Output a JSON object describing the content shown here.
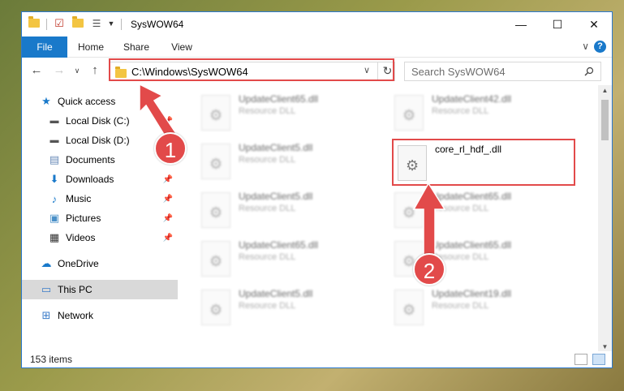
{
  "window": {
    "title": "SysWOW64",
    "minimize": "—",
    "maximize": "☐",
    "close": "✕"
  },
  "ribbon": {
    "tabs": [
      "File",
      "Home",
      "Share",
      "View"
    ],
    "expand": "∨",
    "help": "?"
  },
  "address": {
    "path": "C:\\Windows\\SysWOW64",
    "search_placeholder": "Search SysWOW64"
  },
  "nav_pane": {
    "items": [
      {
        "label": "Quick access",
        "icon": "star-icon"
      },
      {
        "label": "Local Disk (C:)",
        "icon": "drive-icon"
      },
      {
        "label": "Local Disk (D:)",
        "icon": "drive-icon"
      },
      {
        "label": "Documents",
        "icon": "documents-icon"
      },
      {
        "label": "Downloads",
        "icon": "download-icon"
      },
      {
        "label": "Music",
        "icon": "music-icon"
      },
      {
        "label": "Pictures",
        "icon": "pictures-icon"
      },
      {
        "label": "Videos",
        "icon": "videos-icon"
      },
      {
        "label": "OneDrive",
        "icon": "cloud-icon"
      },
      {
        "label": "This PC",
        "icon": "pc-icon"
      },
      {
        "label": "Network",
        "icon": "network-icon"
      }
    ]
  },
  "files": {
    "left": [
      {
        "name": "UpdateClient65.dll",
        "desc": "Resource DLL"
      },
      {
        "name": "UpdateClient5.dll",
        "desc": "Resource DLL"
      },
      {
        "name": "UpdateClient5.dll",
        "desc": "Resource DLL"
      },
      {
        "name": "UpdateClient65.dll",
        "desc": "Resource DLL"
      },
      {
        "name": "UpdateClient5.dll",
        "desc": "Resource DLL"
      }
    ],
    "right": [
      {
        "name": "UpdateClient42.dll",
        "desc": "Resource DLL"
      },
      {
        "name": "core_rl_hdf_.dll",
        "desc": ""
      },
      {
        "name": "UpdateClient65.dll",
        "desc": "Resource DLL"
      },
      {
        "name": "UpdateClient65.dll",
        "desc": "Resource DLL"
      },
      {
        "name": "UpdateClient19.dll",
        "desc": "Resource DLL"
      }
    ]
  },
  "status": {
    "count": "153 items"
  },
  "annotations": {
    "step1": "1",
    "step2": "2",
    "color": "#e24a4a"
  }
}
